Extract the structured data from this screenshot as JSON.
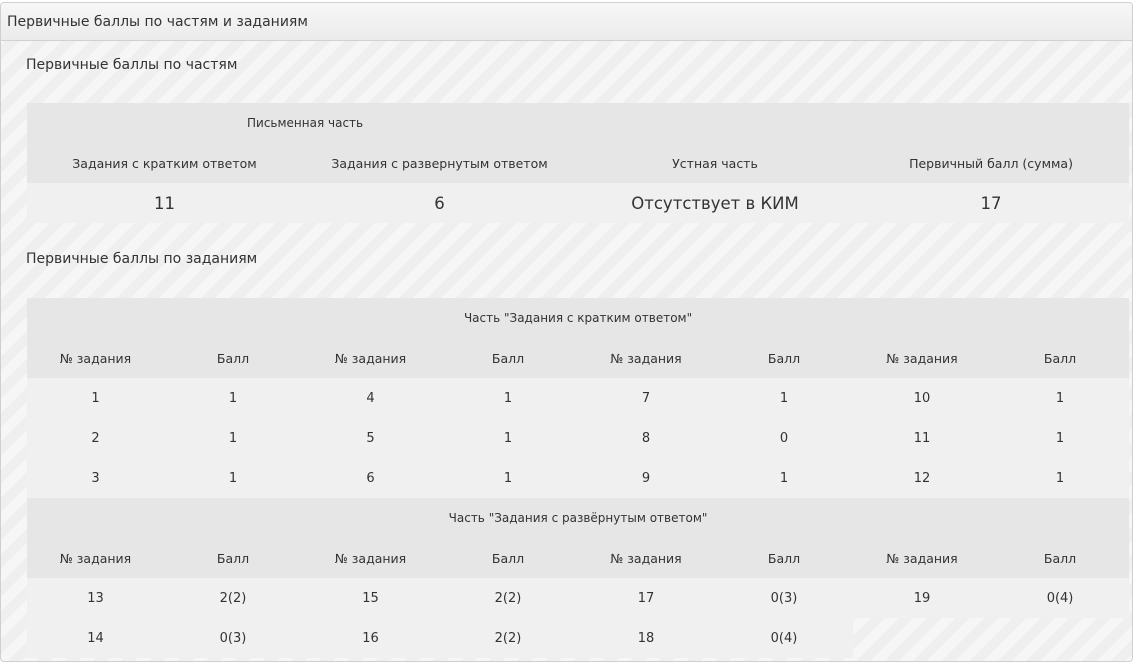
{
  "panel": {
    "title": "Первичные баллы по частям и заданиям"
  },
  "parts_section": {
    "title": "Первичные баллы по частям",
    "written_label": "Письменная часть",
    "columns": [
      "Задания с кратким ответом",
      "Задания с развернутым ответом",
      "Устная часть",
      "Первичный балл (сумма)"
    ],
    "values": [
      "11",
      "6",
      "Отсутствует в КИМ",
      "17"
    ]
  },
  "tasks_section": {
    "title": "Первичные баллы по заданиям",
    "short_part": {
      "title": "Часть \"Задания с кратким ответом\"",
      "headers": [
        "№ задания",
        "Балл",
        "№ задания",
        "Балл",
        "№ задания",
        "Балл",
        "№ задания",
        "Балл"
      ],
      "rows": [
        [
          "1",
          "1",
          "4",
          "1",
          "7",
          "1",
          "10",
          "1"
        ],
        [
          "2",
          "1",
          "5",
          "1",
          "8",
          "0",
          "11",
          "1"
        ],
        [
          "3",
          "1",
          "6",
          "1",
          "9",
          "1",
          "12",
          "1"
        ]
      ]
    },
    "long_part": {
      "title": "Часть \"Задания с развёрнутым ответом\"",
      "headers": [
        "№ задания",
        "Балл",
        "№ задания",
        "Балл",
        "№ задания",
        "Балл",
        "№ задания",
        "Балл"
      ],
      "rows": [
        [
          "13",
          "2(2)",
          "15",
          "2(2)",
          "17",
          "0(3)",
          "19",
          "0(4)"
        ],
        [
          "14",
          "0(3)",
          "16",
          "2(2)",
          "18",
          "0(4)"
        ]
      ]
    }
  }
}
